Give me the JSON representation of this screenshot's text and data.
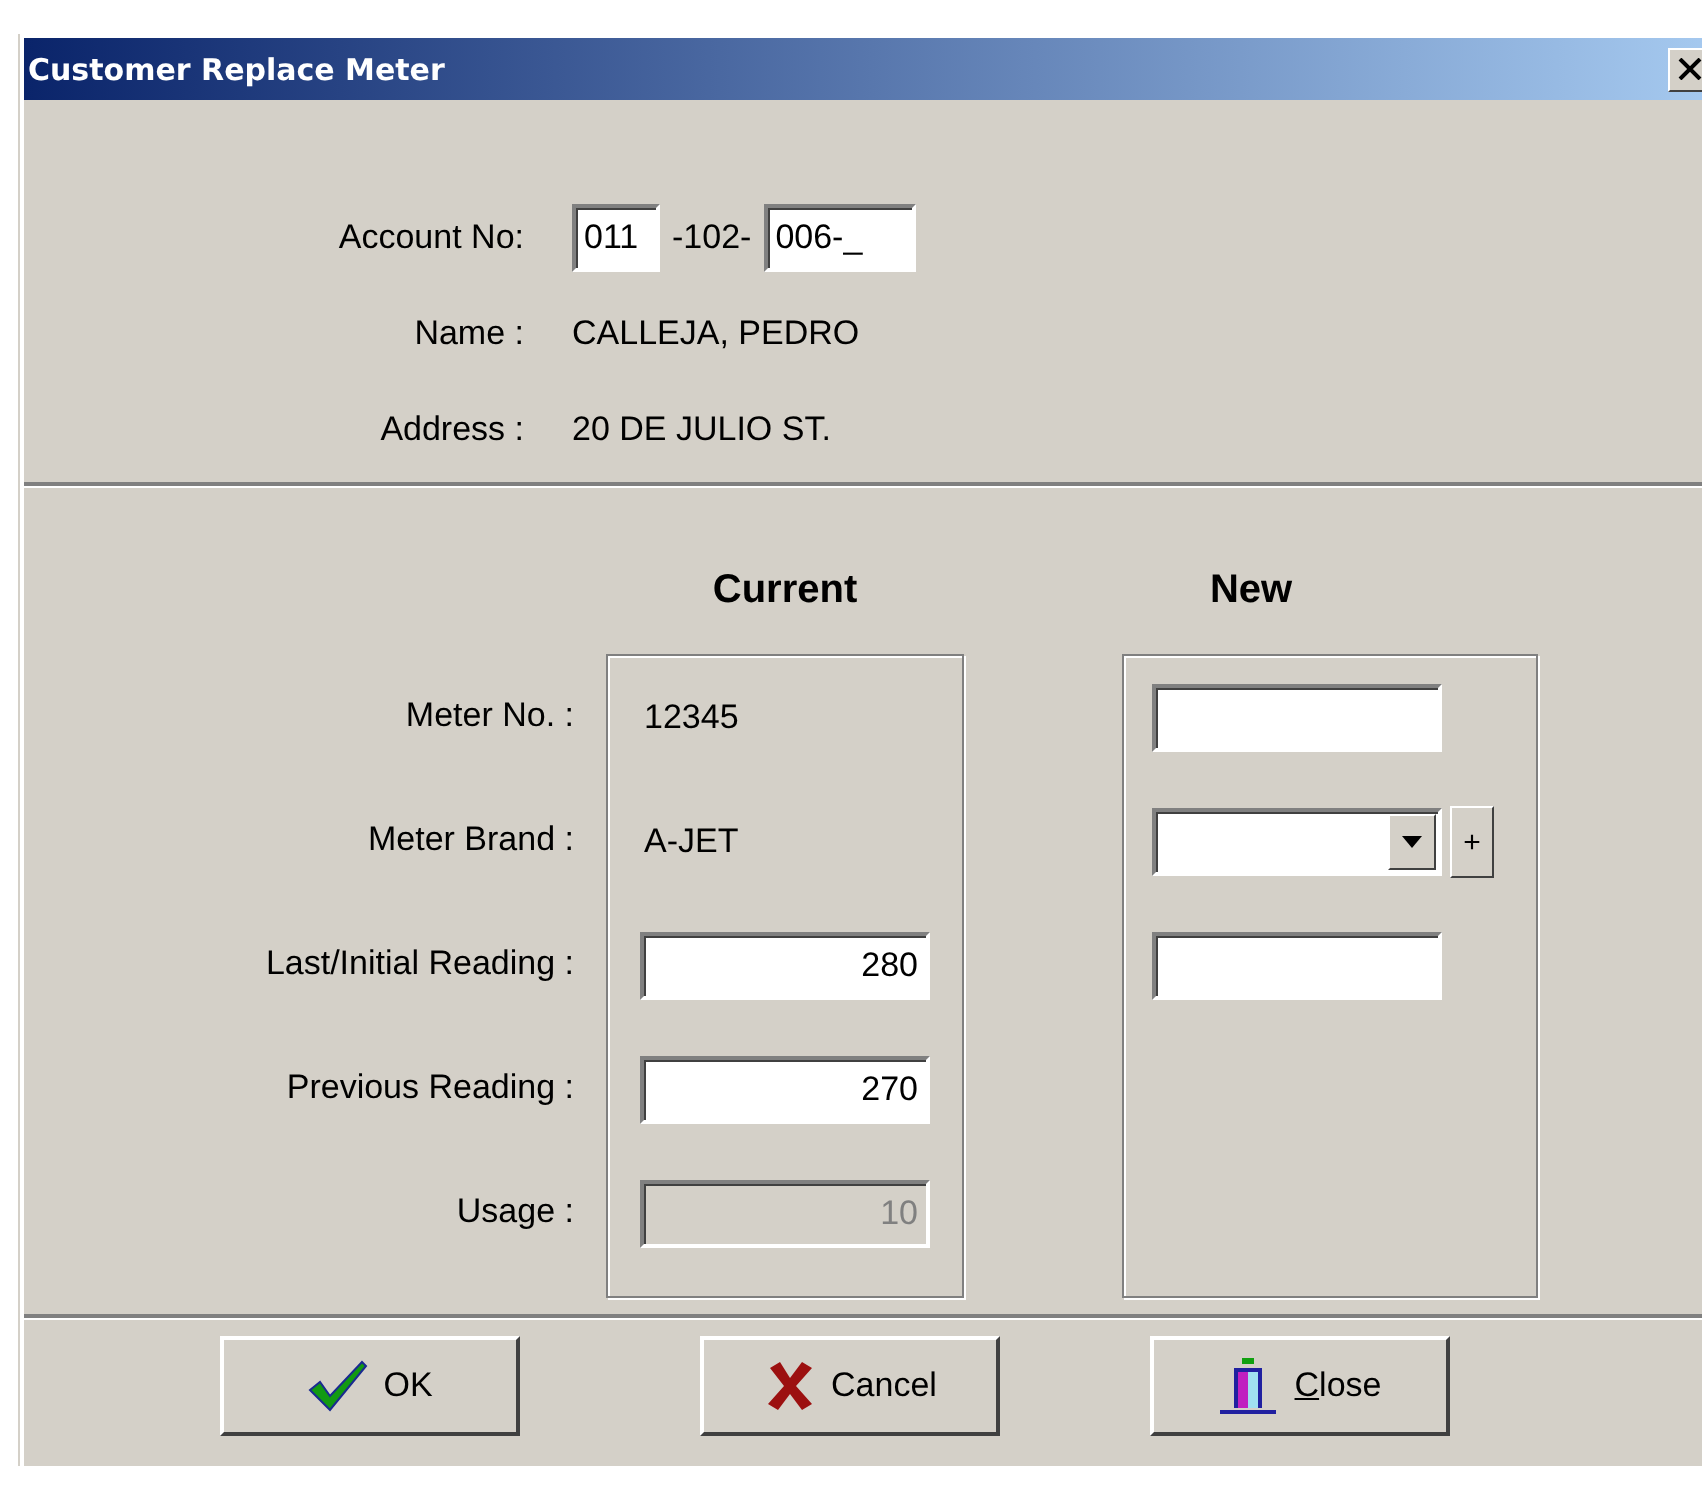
{
  "window": {
    "title": "Customer Replace Meter"
  },
  "account": {
    "label": "Account No:",
    "part_1": "011",
    "separator": "-102-",
    "part_2": "006-_"
  },
  "customer": [
    {
      "label": "Name :",
      "value": "CALLEJA, PEDRO"
    },
    {
      "label": "Address :",
      "value": "20 DE JULIO ST."
    }
  ],
  "columns": [
    "Current",
    "New"
  ],
  "rows": [
    {
      "label": "Meter No. :",
      "current": "12345",
      "kind": "text",
      "new": {
        "kind": "field"
      }
    },
    {
      "label": "Meter Brand :",
      "current": "A-JET",
      "kind": "text",
      "new": {
        "kind": "dropdown"
      }
    },
    {
      "label": "Last/Initial Reading :",
      "current": "280",
      "kind": "field",
      "new": {
        "kind": "field"
      }
    },
    {
      "label": "Previous Reading :",
      "current": "270",
      "kind": "field"
    },
    {
      "label": "Usage :",
      "current": "10",
      "kind": "readonly"
    }
  ],
  "add_button": "+",
  "buttons": [
    {
      "label": "OK",
      "kind": "ok"
    },
    {
      "label": "Cancel",
      "kind": "cancel"
    },
    {
      "label": "Close",
      "kind": "close"
    }
  ]
}
